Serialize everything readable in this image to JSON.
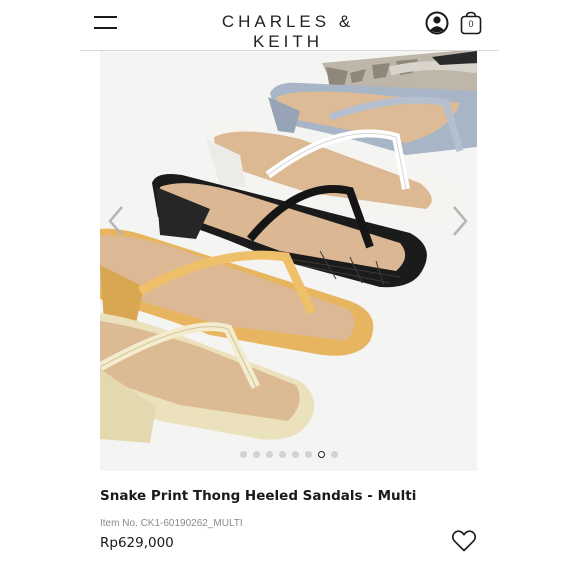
{
  "header": {
    "brand": "CHARLES & KEITH",
    "menu_icon": "hamburger-menu-icon",
    "account_icon": "user-account-icon",
    "bag_icon": "shopping-bag-icon",
    "bag_count": "0"
  },
  "gallery": {
    "prev_icon": "chevron-left-icon",
    "next_icon": "chevron-right-icon",
    "slide_count": 8,
    "active_slide": 7,
    "colors": {
      "snake": "#b8b2a6",
      "grey_blue": "#a7b4c6",
      "white": "#f2f1ee",
      "black": "#1c1c1c",
      "mustard": "#e6b45e",
      "gold": "#e9dfb8",
      "insole": "#dcb993"
    }
  },
  "product": {
    "title": "Snake Print Thong Heeled Sandals - Multi",
    "item_no": "Item No. CK1-60190262_MULTI",
    "price": "Rp629,000",
    "wishlist_icon": "heart-icon"
  }
}
